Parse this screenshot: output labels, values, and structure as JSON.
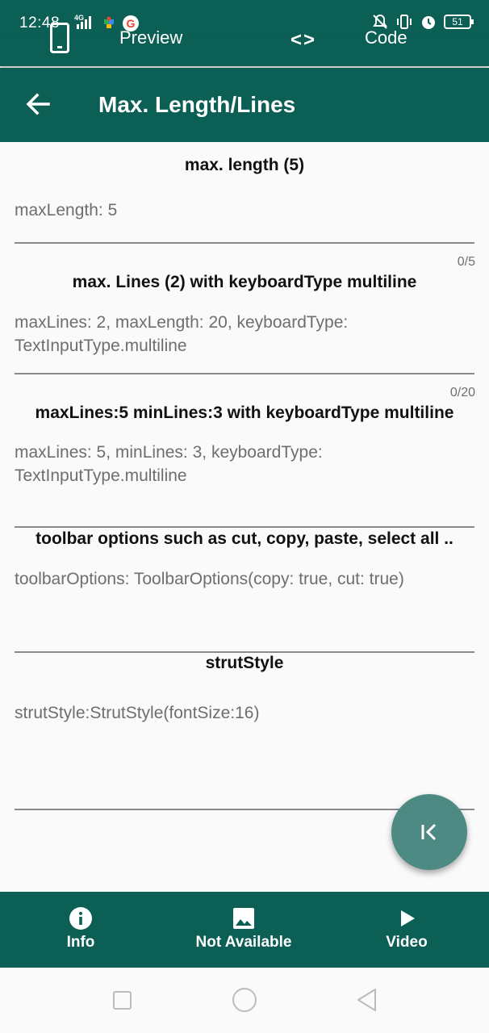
{
  "statusbar": {
    "time": "12:48",
    "network": "4G",
    "google": "G",
    "battery": "51"
  },
  "tabs": {
    "preview_label": "Preview",
    "code_icon": "<>",
    "code_label": "Code"
  },
  "appbar": {
    "title": "Max. Length/Lines"
  },
  "sections": [
    {
      "title": "max. length (5)",
      "value": "maxLength: 5",
      "counter": "0/5"
    },
    {
      "title": "max. Lines (2) with keyboardType multiline",
      "value": "maxLines: 2, maxLength: 20, keyboardType: TextInputType.multiline",
      "counter": "0/20"
    },
    {
      "title": "maxLines:5 minLines:3 with keyboardType multiline",
      "value": "maxLines: 5, minLines: 3, keyboardType: TextInputType.multiline"
    },
    {
      "title": "toolbar options such as cut, copy, paste, select all ..",
      "value": "toolbarOptions: ToolbarOptions(copy: true, cut: true)"
    },
    {
      "title": "strutStyle",
      "value": "strutStyle:StrutStyle(fontSize:16)"
    }
  ],
  "bottom_nav": {
    "info": "Info",
    "not_available": "Not Available",
    "video": "Video"
  },
  "icons": {
    "fab": "first-page-icon",
    "back": "arrow-back-icon",
    "info": "info-icon",
    "image": "image-icon",
    "play": "play-icon"
  },
  "colors": {
    "primary": "#0b5f55",
    "fab": "#4e8a84",
    "hint_text": "#6e6e6e"
  }
}
